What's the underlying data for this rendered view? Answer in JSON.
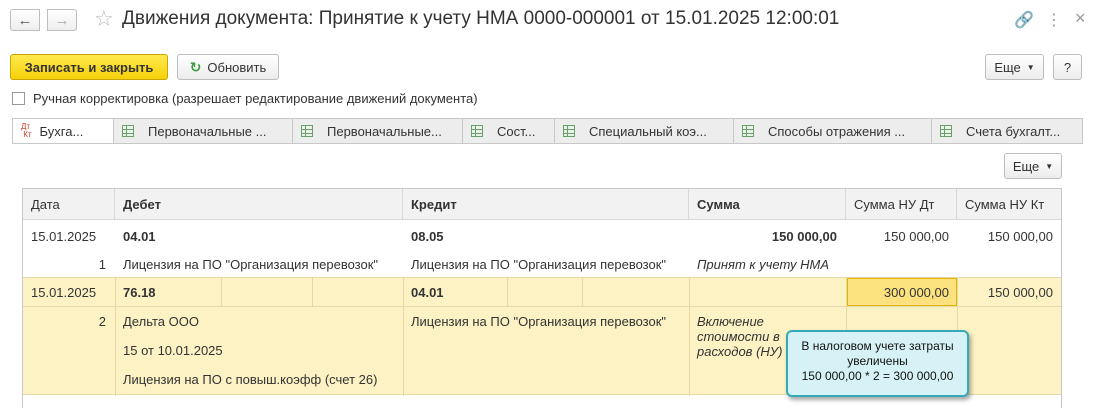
{
  "window": {
    "title": "Движения документа: Принятие к учету НМА 0000-000001 от 15.01.2025 12:00:01"
  },
  "toolbar": {
    "save_close": "Записать и закрыть",
    "refresh": "Обновить",
    "more": "Еще",
    "help": "?"
  },
  "manual": {
    "label": "Ручная корректировка (разрешает редактирование движений документа)",
    "checked": false
  },
  "tabs": [
    {
      "label": "Бухга...",
      "active": true
    },
    {
      "label": "Первоначальные ..."
    },
    {
      "label": "Первоначальные..."
    },
    {
      "label": "Сост..."
    },
    {
      "label": "Специальный коэ..."
    },
    {
      "label": "Способы отражения ..."
    },
    {
      "label": "Счета бухгалт..."
    }
  ],
  "grid": {
    "more": "Еще",
    "columns": [
      "Дата",
      "Дебет",
      "Кредит",
      "Сумма",
      "Сумма НУ Дт",
      "Сумма НУ Кт"
    ],
    "rows": [
      {
        "date": "15.01.2025",
        "num": "1",
        "debit": "04.01",
        "debit_sub": [
          "Лицензия на ПО \"Организация перевозок\""
        ],
        "credit": "08.05",
        "credit_sub": [
          "Лицензия на ПО \"Организация перевозок\""
        ],
        "sum": "150 000,00",
        "sum_note": "Принят к учету НМА",
        "nu_dt": "150 000,00",
        "nu_kt": "150 000,00"
      },
      {
        "date": "15.01.2025",
        "num": "2",
        "debit": "76.18",
        "debit_sub": [
          "Дельта ООО",
          "15 от 10.01.2025",
          "Лицензия на ПО с повыш.коэфф (счет 26)"
        ],
        "credit": "04.01",
        "credit_sub": [
          "Лицензия на ПО \"Организация перевозок\""
        ],
        "sum": "",
        "sum_note": [
          "Включение",
          "стоимости в",
          "расходов (НУ)"
        ],
        "nu_dt": "300 000,00",
        "nu_kt": "150 000,00"
      }
    ]
  },
  "callout": {
    "lines": [
      "В налоговом учете затраты",
      "увеличены",
      "150 000,00 * 2 = 300 000,00"
    ]
  },
  "colors": {
    "primary_button": "#f5d10a",
    "selected_row": "#fcf2c4",
    "highlight_cell": "#fbe27f",
    "callout_bg": "#d6f2f6",
    "callout_border": "#36a9b9"
  }
}
